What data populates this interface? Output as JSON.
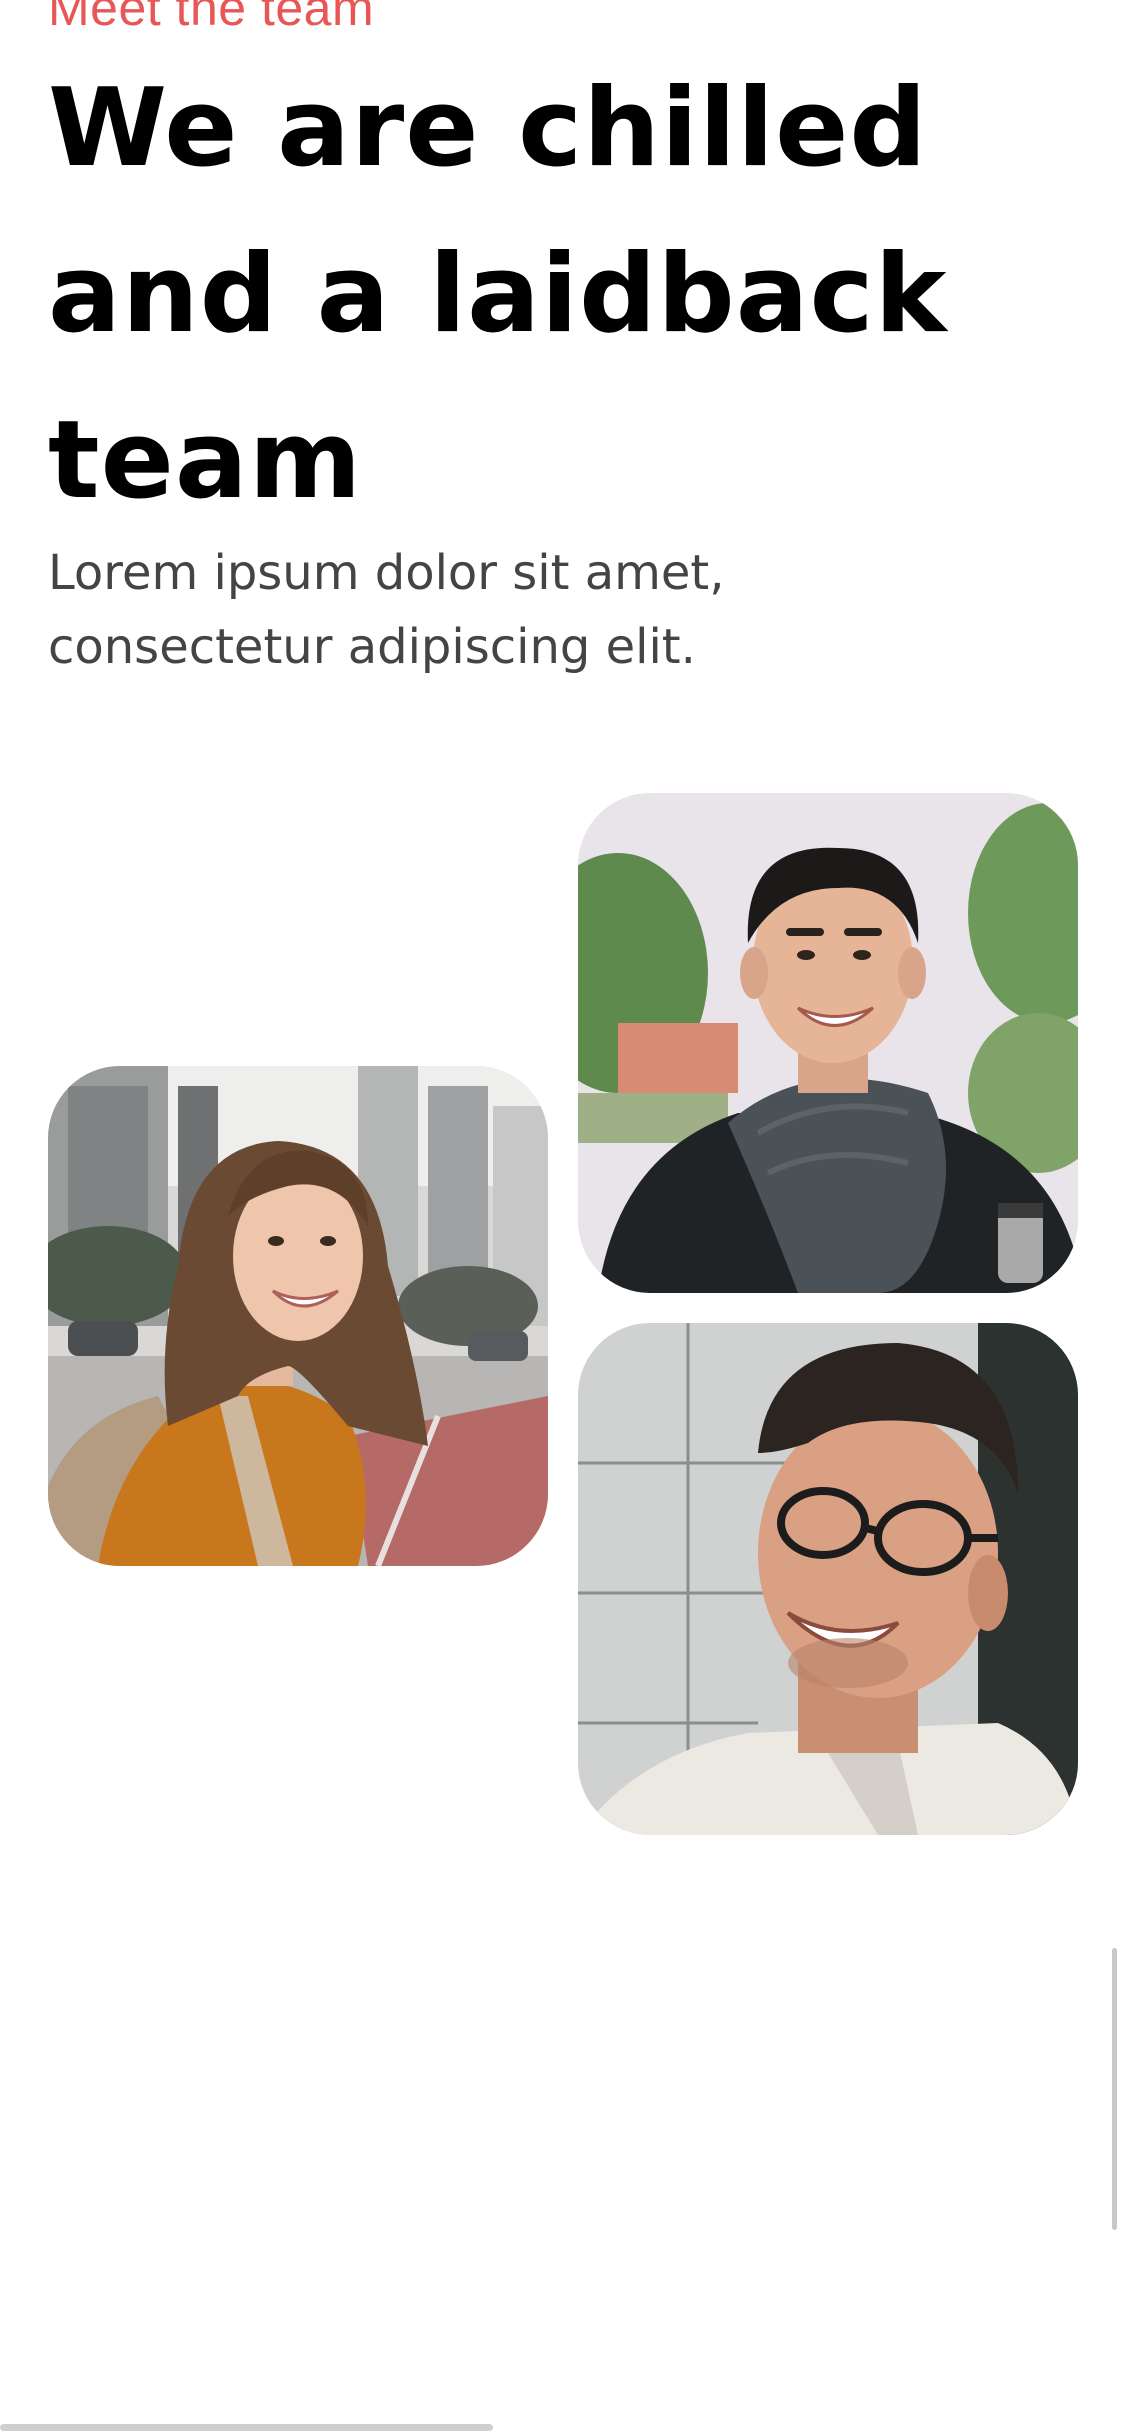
{
  "section": {
    "eyebrow": "Meet the team",
    "headline": "We are chilled and a laidback team",
    "subtitle": "Lorem ipsum dolor sit amet, consectetur adipiscing elit."
  },
  "photos": [
    {
      "name": "woman-portrait",
      "alt": "Smiling woman with backpack on city street"
    },
    {
      "name": "man-scarf-portrait",
      "alt": "Smiling man wearing scarf outdoors"
    },
    {
      "name": "man-glasses-portrait",
      "alt": "Laughing man with glasses"
    }
  ],
  "colors": {
    "accent": "#e85656",
    "headline": "#000000",
    "body_text": "#444444",
    "background": "#ffffff"
  }
}
